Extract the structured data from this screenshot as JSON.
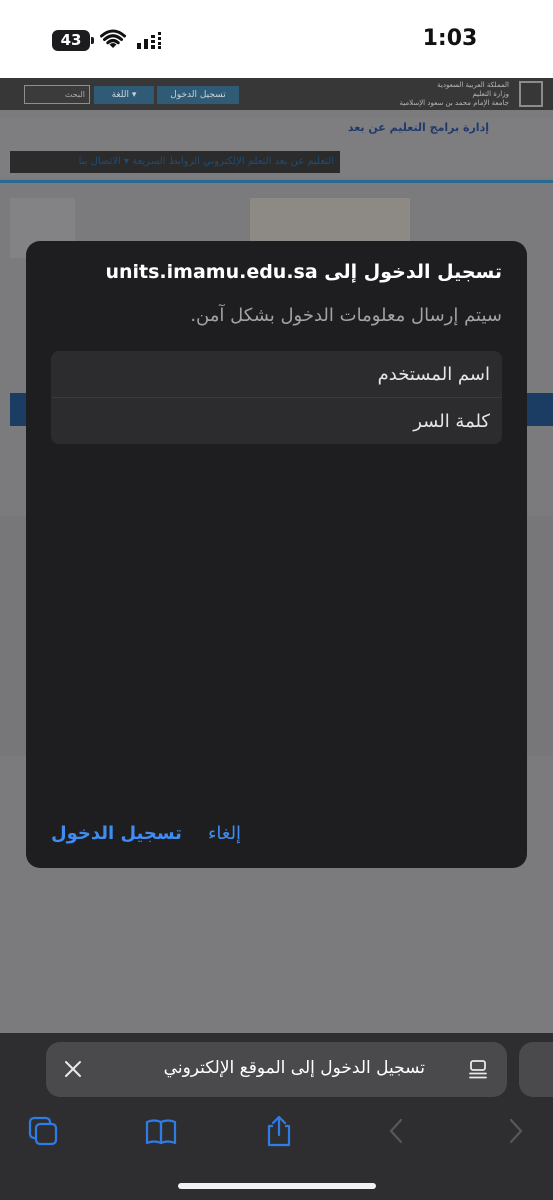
{
  "status_bar": {
    "time": "1:03",
    "battery": "43"
  },
  "website": {
    "university_lines": [
      "المملكة العربية السعودية",
      "وزارة التعليم",
      "جامعة الإمام محمد بن سعود الإسلامية"
    ],
    "login_button": "تسجيل الدخول",
    "language_button": "اللغة ▾",
    "search_placeholder": "البحث",
    "department_title": "إدارة برامج التعليم عن بعد",
    "nav_items": "التعليم عن بعد   التعلم الإلكتروني   الروابط السريعة ▾   الاتصال بنا"
  },
  "auth_dialog": {
    "title": "تسجيل الدخول إلى units.imamu.edu.sa",
    "subtitle": "سيتم إرسال معلومات الدخول بشكل آمن.",
    "username_placeholder": "اسم المستخدم",
    "password_placeholder": "كلمة السر",
    "login_label": "تسجيل الدخول",
    "cancel_label": "إلغاء",
    "accent_color": "#3f8cf3"
  },
  "tab_bar": {
    "title": "تسجيل الدخول إلى الموقع الإلكتروني"
  },
  "toolbar": {
    "icons": [
      "tabs-icon",
      "bookmarks-icon",
      "share-icon",
      "back-icon",
      "forward-icon"
    ]
  }
}
